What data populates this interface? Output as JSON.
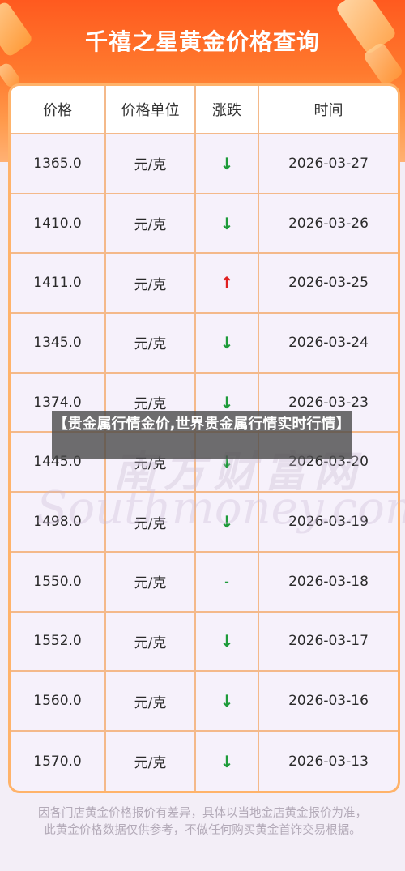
{
  "title": "千禧之星黄金价格查询",
  "table": {
    "headers": [
      "价格",
      "价格单位",
      "涨跌",
      "时间"
    ],
    "rows": [
      {
        "price": "1365.0",
        "unit": "元/克",
        "change": "↓",
        "dir": "down",
        "date": "2026-03-27"
      },
      {
        "price": "1410.0",
        "unit": "元/克",
        "change": "↓",
        "dir": "down",
        "date": "2026-03-26"
      },
      {
        "price": "1411.0",
        "unit": "元/克",
        "change": "↑",
        "dir": "up",
        "date": "2026-03-25"
      },
      {
        "price": "1345.0",
        "unit": "元/克",
        "change": "↓",
        "dir": "down",
        "date": "2026-03-24"
      },
      {
        "price": "1374.0",
        "unit": "元/克",
        "change": "↓",
        "dir": "down",
        "date": "2026-03-23"
      },
      {
        "price": "1445.0",
        "unit": "元/克",
        "change": "↓",
        "dir": "down",
        "date": "2026-03-20"
      },
      {
        "price": "1498.0",
        "unit": "元/克",
        "change": "↓",
        "dir": "down",
        "date": "2026-03-19"
      },
      {
        "price": "1550.0",
        "unit": "元/克",
        "change": "-",
        "dir": "flat",
        "date": "2026-03-18"
      },
      {
        "price": "1552.0",
        "unit": "元/克",
        "change": "↓",
        "dir": "down",
        "date": "2026-03-17"
      },
      {
        "price": "1560.0",
        "unit": "元/克",
        "change": "↓",
        "dir": "down",
        "date": "2026-03-16"
      },
      {
        "price": "1570.0",
        "unit": "元/克",
        "change": "↓",
        "dir": "down",
        "date": "2026-03-13"
      }
    ]
  },
  "overlay_caption": "【贵金属行情金价,世界贵金属行情实时行情】",
  "watermark": {
    "cn": "南方财富网",
    "en": "Southmoney.com"
  },
  "footer": "因各门店黄金价格报价有差异，具体以当地金店黄金报价为准，此黄金价格数据仅供参考，不做任何购买黄金首饰交易根据。",
  "colors": {
    "header_start": "#ff5a1f",
    "header_end": "#ffb174",
    "border": "#ffb36a",
    "up": "#e02020",
    "down": "#1e9b3a"
  }
}
